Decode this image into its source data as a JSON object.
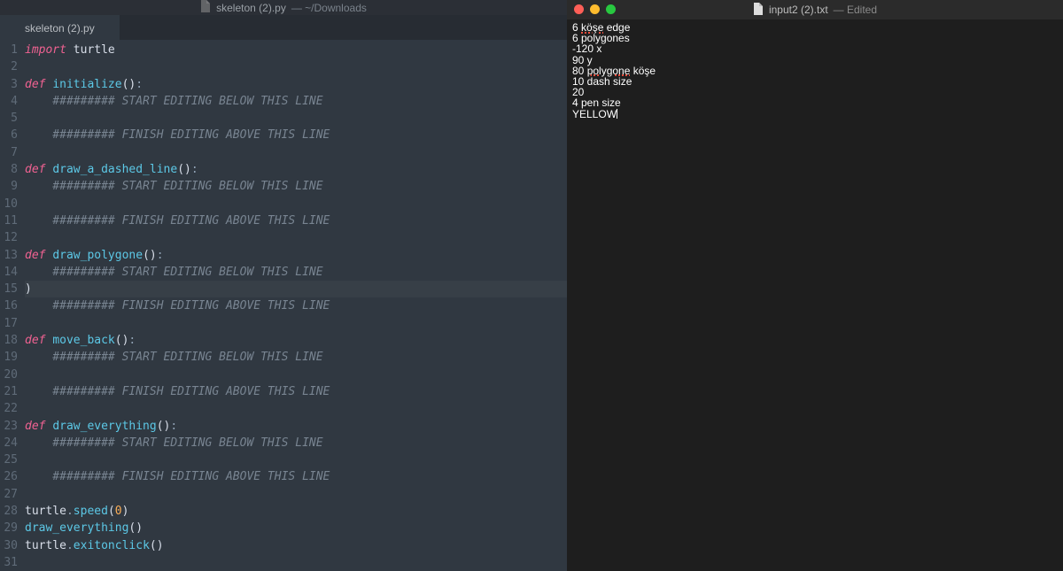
{
  "editor": {
    "title_file": "skeleton (2).py",
    "title_path": "— ~/Downloads",
    "tab": "skeleton (2).py",
    "lines": [
      {
        "n": 1,
        "t": "import",
        "kind": "import"
      },
      {
        "n": 2,
        "t": "",
        "kind": "blank"
      },
      {
        "n": 3,
        "t": "initialize",
        "kind": "def"
      },
      {
        "n": 4,
        "t": "    ######### START EDITING BELOW THIS LINE",
        "kind": "comment"
      },
      {
        "n": 5,
        "t": "",
        "kind": "blank"
      },
      {
        "n": 6,
        "t": "    ######### FINISH EDITING ABOVE THIS LINE",
        "kind": "comment"
      },
      {
        "n": 7,
        "t": "",
        "kind": "blank"
      },
      {
        "n": 8,
        "t": "draw_a_dashed_line",
        "kind": "def"
      },
      {
        "n": 9,
        "t": "    ######### START EDITING BELOW THIS LINE",
        "kind": "comment"
      },
      {
        "n": 10,
        "t": "",
        "kind": "blank"
      },
      {
        "n": 11,
        "t": "    ######### FINISH EDITING ABOVE THIS LINE",
        "kind": "comment"
      },
      {
        "n": 12,
        "t": "",
        "kind": "blank"
      },
      {
        "n": 13,
        "t": "draw_polygone",
        "kind": "def"
      },
      {
        "n": 14,
        "t": "    ######### START EDITING BELOW THIS LINE",
        "kind": "comment"
      },
      {
        "n": 15,
        "t": ")",
        "kind": "paren",
        "current": true
      },
      {
        "n": 16,
        "t": "    ######### FINISH EDITING ABOVE THIS LINE",
        "kind": "comment"
      },
      {
        "n": 17,
        "t": "",
        "kind": "blank"
      },
      {
        "n": 18,
        "t": "move_back",
        "kind": "def"
      },
      {
        "n": 19,
        "t": "    ######### START EDITING BELOW THIS LINE",
        "kind": "comment"
      },
      {
        "n": 20,
        "t": "",
        "kind": "blank"
      },
      {
        "n": 21,
        "t": "    ######### FINISH EDITING ABOVE THIS LINE",
        "kind": "comment"
      },
      {
        "n": 22,
        "t": "",
        "kind": "blank"
      },
      {
        "n": 23,
        "t": "draw_everything",
        "kind": "def"
      },
      {
        "n": 24,
        "t": "    ######### START EDITING BELOW THIS LINE",
        "kind": "comment"
      },
      {
        "n": 25,
        "t": "",
        "kind": "blank"
      },
      {
        "n": 26,
        "t": "    ######### FINISH EDITING ABOVE THIS LINE",
        "kind": "comment"
      },
      {
        "n": 27,
        "t": "",
        "kind": "blank"
      },
      {
        "n": 28,
        "t": "speed|0",
        "kind": "call"
      },
      {
        "n": 29,
        "t": "draw_everything",
        "kind": "bare-call"
      },
      {
        "n": 30,
        "t": "exitonclick",
        "kind": "call-noarg"
      },
      {
        "n": 31,
        "t": "",
        "kind": "blank"
      }
    ],
    "module": "turtle"
  },
  "textedit": {
    "title_file": "input2 (2).txt",
    "title_status": "— Edited",
    "lines": [
      {
        "pre": "6 ",
        "sq": "köşe",
        "post": " edge"
      },
      {
        "pre": "6 polygones"
      },
      {
        "pre": "-120 x"
      },
      {
        "pre": "90 y"
      },
      {
        "pre": "80 ",
        "sq": "polygone",
        "post": " köşe"
      },
      {
        "pre": "10 dash size"
      },
      {
        "pre": "20"
      },
      {
        "pre": "4 pen size"
      },
      {
        "pre": "YELLOW",
        "cursor": true
      }
    ]
  }
}
